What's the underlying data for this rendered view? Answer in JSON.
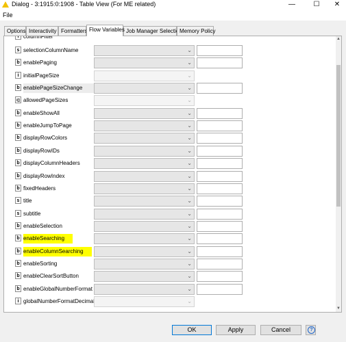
{
  "window": {
    "title": "Dialog - 3:1915:0:1908 - Table View (For ME related)",
    "minimize_glyph": "—",
    "maximize_glyph": "☐",
    "close_glyph": "✕"
  },
  "menu": {
    "items": [
      "File"
    ]
  },
  "tabs": [
    {
      "label": "Options",
      "active": false
    },
    {
      "label": "Interactivity",
      "active": false
    },
    {
      "label": "Formatters",
      "active": false
    },
    {
      "label": "Flow Variables",
      "active": true
    },
    {
      "label": "Job Manager Selection",
      "active": false
    },
    {
      "label": "Memory Policy",
      "active": false
    }
  ],
  "variables": {
    "partial_top_label": "columnFilter",
    "rows": [
      {
        "icon": "s",
        "label": "selectionColumnName",
        "disabled": false,
        "highlighted": false
      },
      {
        "icon": "b",
        "label": "enablePaging",
        "disabled": false,
        "highlighted": false
      },
      {
        "icon": "i",
        "label": "initialPageSize",
        "disabled": true,
        "highlighted": false
      },
      {
        "icon": "b",
        "label": "enablePageSizeChange",
        "disabled": false,
        "highlighted": false
      },
      {
        "icon": "i[]",
        "label": "allowedPageSizes",
        "disabled": true,
        "highlighted": false
      },
      {
        "icon": "b",
        "label": "enableShowAll",
        "disabled": false,
        "highlighted": false
      },
      {
        "icon": "b",
        "label": "enableJumpToPage",
        "disabled": false,
        "highlighted": false
      },
      {
        "icon": "b",
        "label": "displayRowColors",
        "disabled": false,
        "highlighted": false
      },
      {
        "icon": "b",
        "label": "displayRowIDs",
        "disabled": false,
        "highlighted": false
      },
      {
        "icon": "b",
        "label": "displayColumnHeaders",
        "disabled": false,
        "highlighted": false
      },
      {
        "icon": "b",
        "label": "displayRowIndex",
        "disabled": false,
        "highlighted": false
      },
      {
        "icon": "b",
        "label": "fixedHeaders",
        "disabled": false,
        "highlighted": false
      },
      {
        "icon": "s",
        "label": "title",
        "disabled": false,
        "highlighted": false
      },
      {
        "icon": "s",
        "label": "subtitle",
        "disabled": false,
        "highlighted": false
      },
      {
        "icon": "b",
        "label": "enableSelection",
        "disabled": false,
        "highlighted": false
      },
      {
        "icon": "b",
        "label": "enableSearching",
        "disabled": false,
        "highlighted": true
      },
      {
        "icon": "b",
        "label": "enableColumnSearching",
        "disabled": false,
        "highlighted": true
      },
      {
        "icon": "b",
        "label": "enableSorting",
        "disabled": false,
        "highlighted": false
      },
      {
        "icon": "b",
        "label": "enableClearSortButton",
        "disabled": false,
        "highlighted": false
      },
      {
        "icon": "b",
        "label": "enableGlobalNumberFormat",
        "disabled": false,
        "highlighted": false
      },
      {
        "icon": "i",
        "label": "globalNumberFormatDecimals",
        "disabled": true,
        "highlighted": false
      }
    ]
  },
  "buttons": {
    "ok": "OK",
    "apply": "Apply",
    "cancel": "Cancel",
    "help": "?"
  },
  "colors": {
    "highlight": "#ffff00",
    "warning_icon": "#f2c200",
    "default_button_border": "#0078d7"
  },
  "icons": {
    "title": "warning-triangle-icon",
    "scroll_up": "chevron-up-icon",
    "scroll_down": "chevron-down-icon",
    "combo": "chevron-down-icon",
    "help": "help-icon"
  }
}
